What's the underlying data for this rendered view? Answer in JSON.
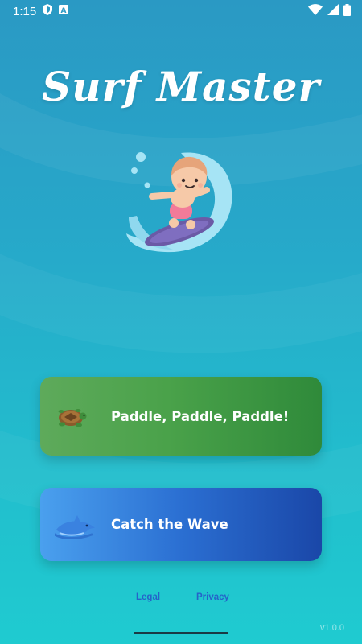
{
  "status_bar": {
    "time": "1:15",
    "icons": [
      "shield-icon",
      "font-a-icon",
      "wifi-icon",
      "signal-icon",
      "battery-icon"
    ]
  },
  "app": {
    "title": "Surf Master",
    "hero_image": "surfer-illustration"
  },
  "buttons": {
    "paddle": {
      "label": "Paddle, Paddle, Paddle!",
      "icon": "turtle-icon",
      "color_from": "#5eaa5b",
      "color_to": "#2f8a3a"
    },
    "wave": {
      "label": "Catch the Wave",
      "icon": "dolphin-icon",
      "color_from": "#4aa0ee",
      "color_to": "#1a47a8"
    }
  },
  "footer": {
    "legal": "Legal",
    "privacy": "Privacy",
    "version": "v1.0.0"
  }
}
